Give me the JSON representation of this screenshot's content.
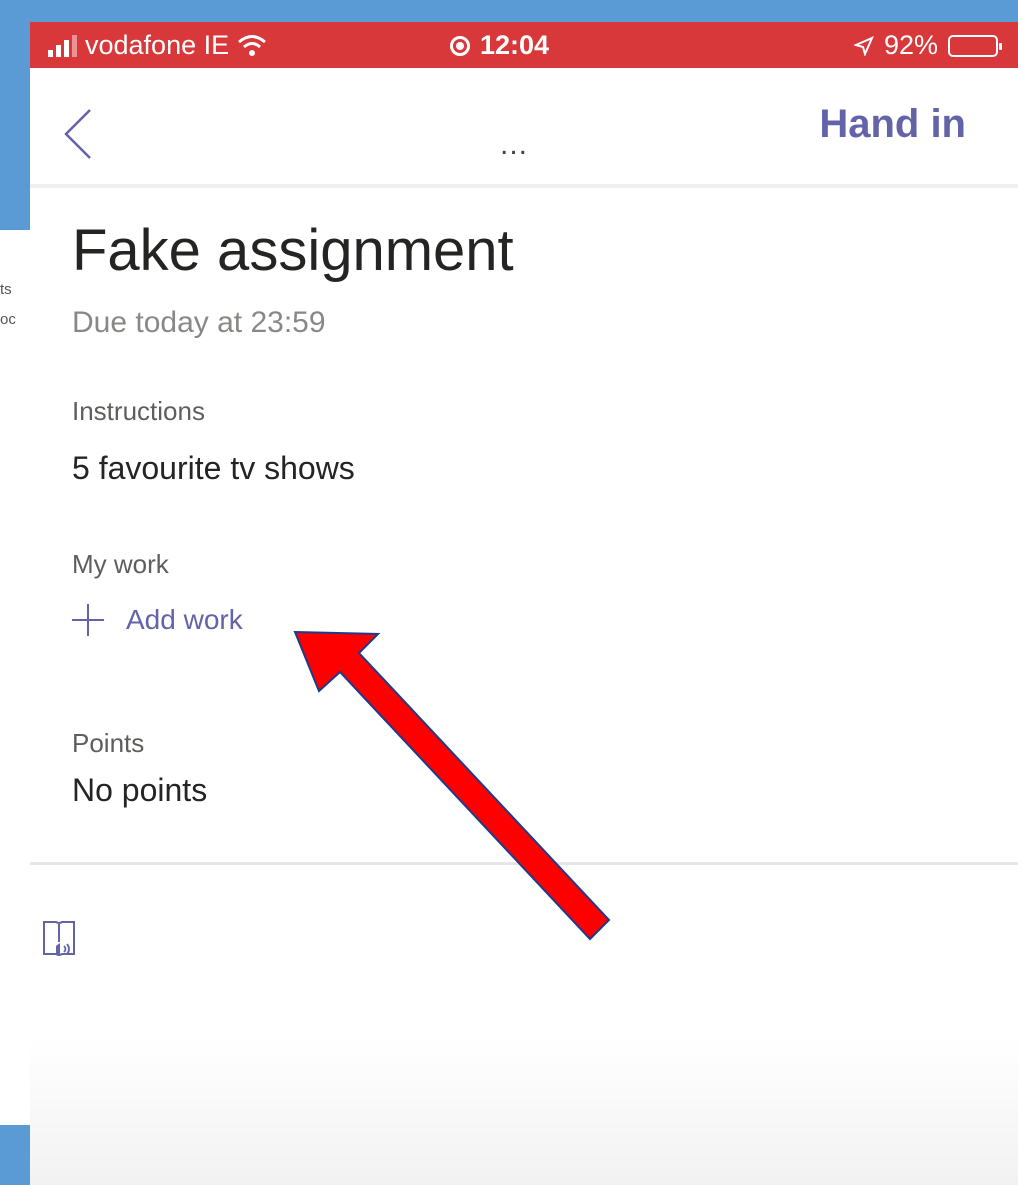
{
  "status_bar": {
    "carrier": "vodafone IE",
    "time": "12:04",
    "battery_percent": "92%",
    "battery_level": 0.92,
    "background_color": "#d9383a"
  },
  "nav": {
    "back_icon": "chevron-left-icon",
    "more_label": "...",
    "hand_in_label": "Hand in",
    "accent_color": "#6264a7"
  },
  "assignment": {
    "title": "Fake assignment",
    "due": "Due today at 23:59",
    "instructions_label": "Instructions",
    "instructions_text": "5 favourite tv shows",
    "my_work_label": "My work",
    "add_work_label": "Add work",
    "points_label": "Points",
    "points_value": "No points"
  },
  "background_fragments": [
    "ts",
    "oc"
  ],
  "annotation": {
    "arrow_color": "#ff0000"
  }
}
